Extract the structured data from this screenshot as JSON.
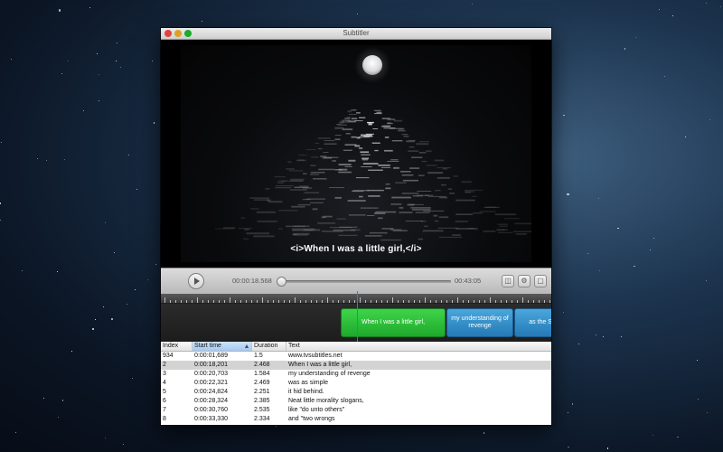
{
  "window": {
    "title": "Subtitler",
    "traffic_lights": {
      "close_color": "#e0443e",
      "minimize_color": "#dea123",
      "zoom_color": "#1aab29"
    }
  },
  "video": {
    "subtitle_overlay": "<i>When I was a little girl,</i>"
  },
  "controls": {
    "current_time": "00:00:18.568",
    "total_time": "00:43:05",
    "position_fraction": 0.007,
    "play_icon": "play-icon",
    "buttons": [
      "camera-icon",
      "settings-icon",
      "subtitle-icon"
    ]
  },
  "timeline": {
    "blocks": [
      {
        "text": "When I was a little girl,",
        "color": "#2bbd36"
      },
      {
        "text": "my understanding of revenge",
        "color": "#2f8fcf"
      },
      {
        "text": "as the Su",
        "color": "#2f8fcf"
      }
    ],
    "playhead_color": "#d35400"
  },
  "table": {
    "columns": [
      "Index",
      "Start time",
      "Duration",
      "Text"
    ],
    "sorted_column": "Start time",
    "rows": [
      {
        "index": "934",
        "start": "0:00:01,689",
        "duration": "1.5",
        "text": "www.tvsubtitles.net",
        "selected": false
      },
      {
        "index": "2",
        "start": "0:00:18,201",
        "duration": "2.468",
        "text": "When I was a little girl,",
        "selected": true
      },
      {
        "index": "3",
        "start": "0:00:20,703",
        "duration": "1.584",
        "text": "my understanding of revenge",
        "selected": false
      },
      {
        "index": "4",
        "start": "0:00:22,321",
        "duration": "2.469",
        "text": "was as simple",
        "selected": false
      },
      {
        "index": "5",
        "start": "0:00:24,824",
        "duration": "2.251",
        "text": "it hid behind.",
        "selected": false
      },
      {
        "index": "6",
        "start": "0:00:28,324",
        "duration": "2.385",
        "text": "Neat little morality slogans,",
        "selected": false
      },
      {
        "index": "7",
        "start": "0:00:30,760",
        "duration": "2.535",
        "text": "like \"do unto others\"",
        "selected": false
      },
      {
        "index": "8",
        "start": "0:00:33,330",
        "duration": "2.334",
        "text": "and \"two wrongs",
        "selected": false
      }
    ]
  }
}
